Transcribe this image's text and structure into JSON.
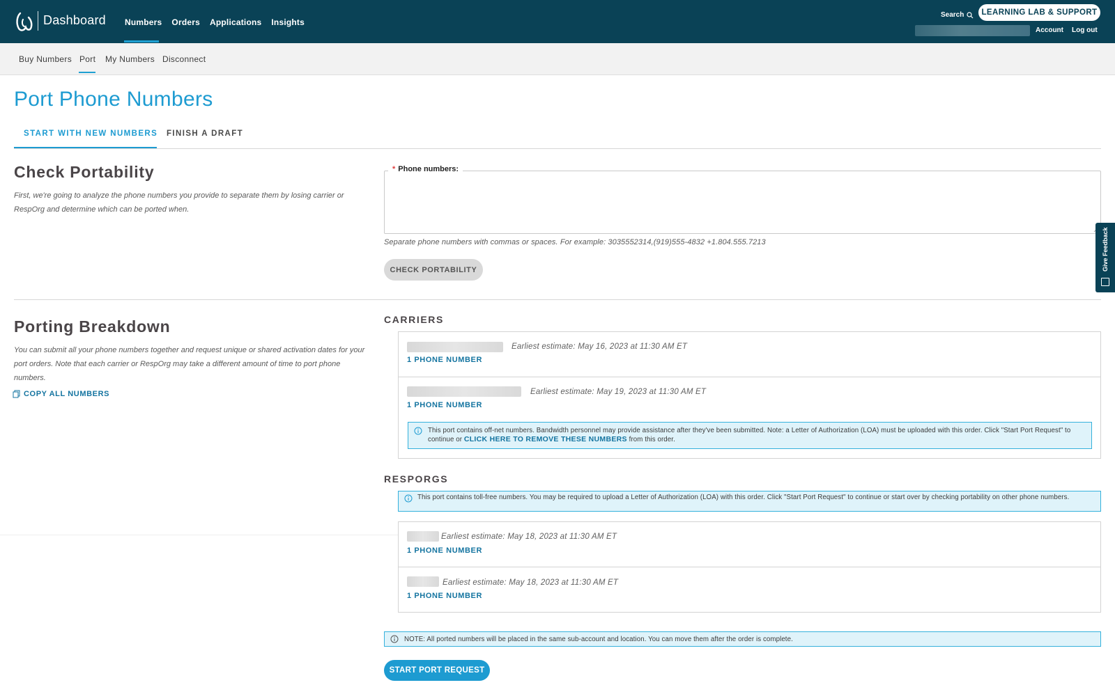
{
  "header": {
    "brand": "Dashboard",
    "nav": [
      "Numbers",
      "Orders",
      "Applications",
      "Insights"
    ],
    "search_label": "Search",
    "learning_button": "LEARNING LAB & SUPPORT",
    "account_label": "Account",
    "logout_label": "Log out"
  },
  "subnav": {
    "items": [
      "Buy Numbers",
      "Port",
      "My Numbers",
      "Disconnect"
    ],
    "active": "Port"
  },
  "page": {
    "title": "Port Phone Numbers",
    "tabs": [
      "START WITH NEW NUMBERS",
      "FINISH A DRAFT"
    ],
    "active_tab": "START WITH NEW NUMBERS"
  },
  "check_portability": {
    "heading": "Check Portability",
    "description": "First, we're going to analyze the phone numbers you provide to separate them by losing carrier or RespOrg and determine which can be ported when.",
    "field_label": "Phone numbers:",
    "field_value": "",
    "hint": "Separate phone numbers with commas or spaces. For example: 3035552314,(919)555-4832 +1.804.555.7213",
    "button": "CHECK PORTABILITY"
  },
  "porting_breakdown": {
    "heading": "Porting Breakdown",
    "description": "You can submit all your phone numbers together and request unique or shared activation dates for your port orders. Note that each carrier or RespOrg may take a different amount of time to port phone numbers.",
    "copy_all": "COPY ALL NUMBERS",
    "carriers_heading": "CARRIERS",
    "carriers": [
      {
        "estimate": "Earliest estimate: May 16, 2023 at 11:30 AM ET",
        "count_link": "1 PHONE NUMBER"
      },
      {
        "estimate": "Earliest estimate: May 19, 2023 at 11:30 AM ET",
        "count_link": "1 PHONE NUMBER",
        "notice_pre": "This port contains off-net numbers. Bandwidth personnel may provide assistance after they've been submitted. Note: a Letter of Authorization (LOA) must be uploaded with this order. Click \"Start Port Request\" to continue or ",
        "notice_link": "CLICK HERE TO REMOVE THESE NUMBERS",
        "notice_post": " from this order."
      }
    ],
    "resporgs_heading": "RESPORGS",
    "resporgs_notice": "This port contains toll-free numbers. You may be required to upload a Letter of Authorization (LOA) with this order. Click \"Start Port Request\" to continue or start over by checking portability on other phone numbers.",
    "resporgs": [
      {
        "estimate": "Earliest estimate: May 18, 2023 at 11:30 AM ET",
        "count_link": "1 PHONE NUMBER"
      },
      {
        "estimate": "Earliest estimate: May 18, 2023 at 11:30 AM ET",
        "count_link": "1 PHONE NUMBER"
      }
    ],
    "footer_note": "NOTE: All ported numbers will be placed in the same sub-account and location. You can move them after the order is complete.",
    "start_button": "START PORT REQUEST"
  },
  "feedback_tab": "Give Feedback",
  "colors": {
    "header": "#0a4256",
    "accent": "#1d9bd1",
    "link": "#1474a0",
    "notice_bg": "#dff3fa"
  }
}
